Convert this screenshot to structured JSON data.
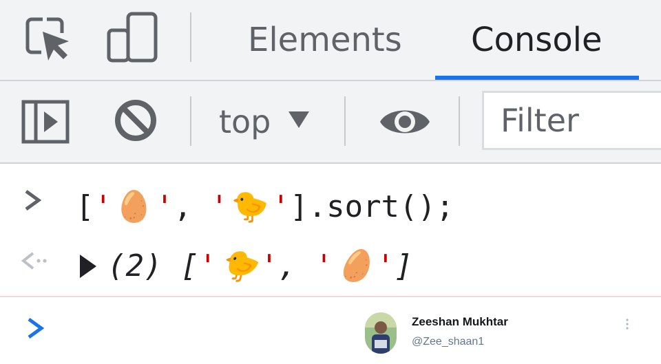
{
  "tabs": {
    "elements": "Elements",
    "console": "Console",
    "active": "Console"
  },
  "toolbar": {
    "context": "top",
    "filter_placeholder": "Filter"
  },
  "console": {
    "input": {
      "open_bracket": "[",
      "quote": "'",
      "comma": ",",
      "egg": "🥚",
      "chick": "🐤",
      "close_bracket": "]",
      "call": ".sort();"
    },
    "output": {
      "count": "(2)",
      "open_bracket": "[",
      "quote": "'",
      "comma": ",",
      "first": "🐤",
      "second": "🥚",
      "close_bracket": "]"
    }
  },
  "author": {
    "name": "Zeeshan Mukhtar",
    "handle": "@Zee_shaan1"
  },
  "colors": {
    "accent": "#1a73e8",
    "string_quote": "#c80000",
    "prompt_active": "#1a73e8",
    "icon_gray": "#5f6368"
  },
  "icons": [
    "inspect-element-icon",
    "device-toolbar-icon",
    "sidebar-toggle-icon",
    "clear-console-icon",
    "dropdown-arrow-icon",
    "eye-icon",
    "chevron-right-icon",
    "return-arrow-icon",
    "expand-triangle-icon",
    "more-vertical-icon"
  ]
}
